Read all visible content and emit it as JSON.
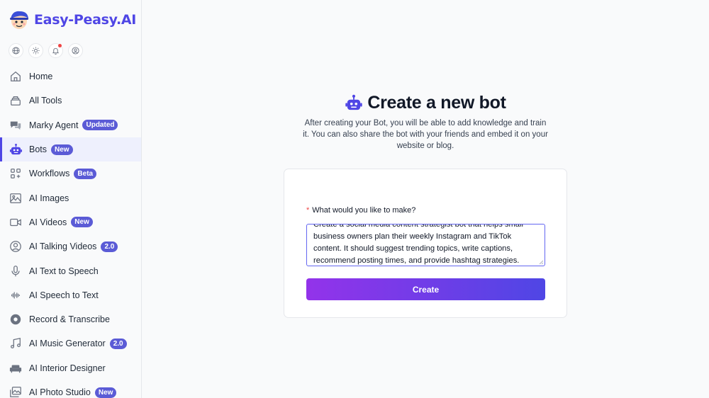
{
  "brand": {
    "name": "Easy-Peasy.AI",
    "logo": "mascot-logo"
  },
  "quick_icons": [
    "globe-icon",
    "sun-icon",
    "bell-icon",
    "user-circle-icon"
  ],
  "sidebar": {
    "items": [
      {
        "label": "Home",
        "icon": "home-icon",
        "badge": ""
      },
      {
        "label": "All Tools",
        "icon": "layers-icon",
        "badge": ""
      },
      {
        "label": "Marky Agent",
        "icon": "chat-icon",
        "badge": "Updated"
      },
      {
        "label": "Bots",
        "icon": "robot-icon",
        "badge": "New",
        "active": true
      },
      {
        "label": "Workflows",
        "icon": "grid-icon",
        "badge": "Beta"
      },
      {
        "label": "AI Images",
        "icon": "image-icon",
        "badge": ""
      },
      {
        "label": "AI Videos",
        "icon": "video-icon",
        "badge": "New"
      },
      {
        "label": "AI Talking Videos",
        "icon": "face-icon",
        "badge": "2.0"
      },
      {
        "label": "AI Text to Speech",
        "icon": "microphone-icon",
        "badge": ""
      },
      {
        "label": "AI Speech to Text",
        "icon": "waveform-icon",
        "badge": ""
      },
      {
        "label": "Record & Transcribe",
        "icon": "record-icon",
        "badge": ""
      },
      {
        "label": "AI Music Generator",
        "icon": "music-icon",
        "badge": "2.0"
      },
      {
        "label": "AI Interior Designer",
        "icon": "sofa-icon",
        "badge": ""
      },
      {
        "label": "AI Photo Studio",
        "icon": "photos-icon",
        "badge": "New"
      }
    ]
  },
  "main": {
    "title": "Create a new bot",
    "subtitle": "After creating your Bot, you will be able to add knowledge and train it. You can also share the bot with your friends and embed it on your website or blog.",
    "form": {
      "label": "What would you like to make?",
      "required_marker": "*",
      "value": "Create a social media content strategist bot that helps small business owners plan their weekly Instagram and TikTok content. It should suggest trending topics, write captions, recommend posting times, and provide hashtag strategies.",
      "submit_label": "Create"
    }
  },
  "colors": {
    "accent": "#4f46e5",
    "gradient_start": "#9333ea",
    "gradient_end": "#4f46e5",
    "badge": "#5b5bd6",
    "required": "#ef4444"
  }
}
